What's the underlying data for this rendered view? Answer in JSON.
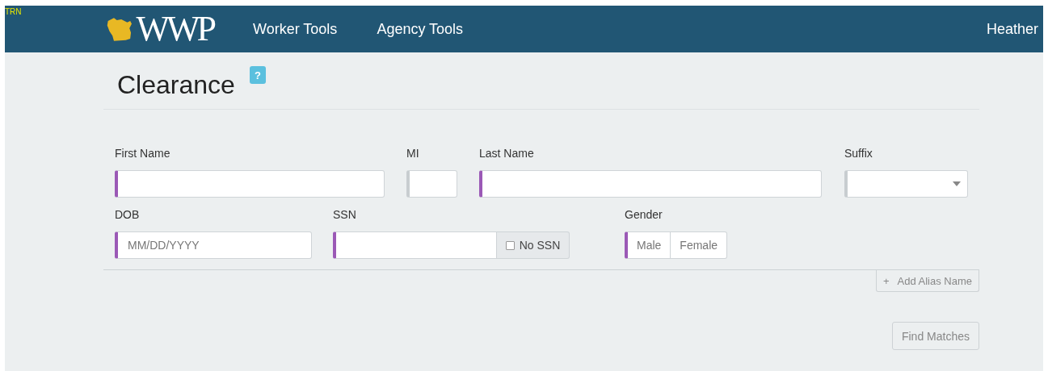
{
  "env_badge": "TRN",
  "logo": {
    "text": "WWP"
  },
  "nav": [
    {
      "label": "Worker Tools"
    },
    {
      "label": "Agency Tools"
    }
  ],
  "user": "Heather",
  "page": {
    "title": "Clearance",
    "help": "?"
  },
  "rows": [
    [
      {
        "kind": "text",
        "label": "First Name",
        "required": true
      },
      {
        "kind": "text",
        "label": "MI",
        "required": false
      },
      {
        "kind": "text",
        "label": "Last Name",
        "required": true
      },
      {
        "kind": "select",
        "label": "Suffix",
        "required": false
      }
    ],
    [
      {
        "kind": "text",
        "label": "DOB",
        "required": true,
        "placeholder": "MM/DD/YYYY"
      },
      {
        "kind": "ssn",
        "label": "SSN",
        "required": true,
        "addon": {
          "label": "No SSN",
          "checked": false
        }
      },
      {
        "kind": "toggle",
        "label": "Gender",
        "required": true,
        "options": [
          {
            "label": "Male",
            "selected": false
          },
          {
            "label": "Female",
            "selected": false
          }
        ]
      }
    ]
  ],
  "add_alias": {
    "icon": "+",
    "label": "Add Alias Name"
  },
  "find_button": "Find Matches"
}
